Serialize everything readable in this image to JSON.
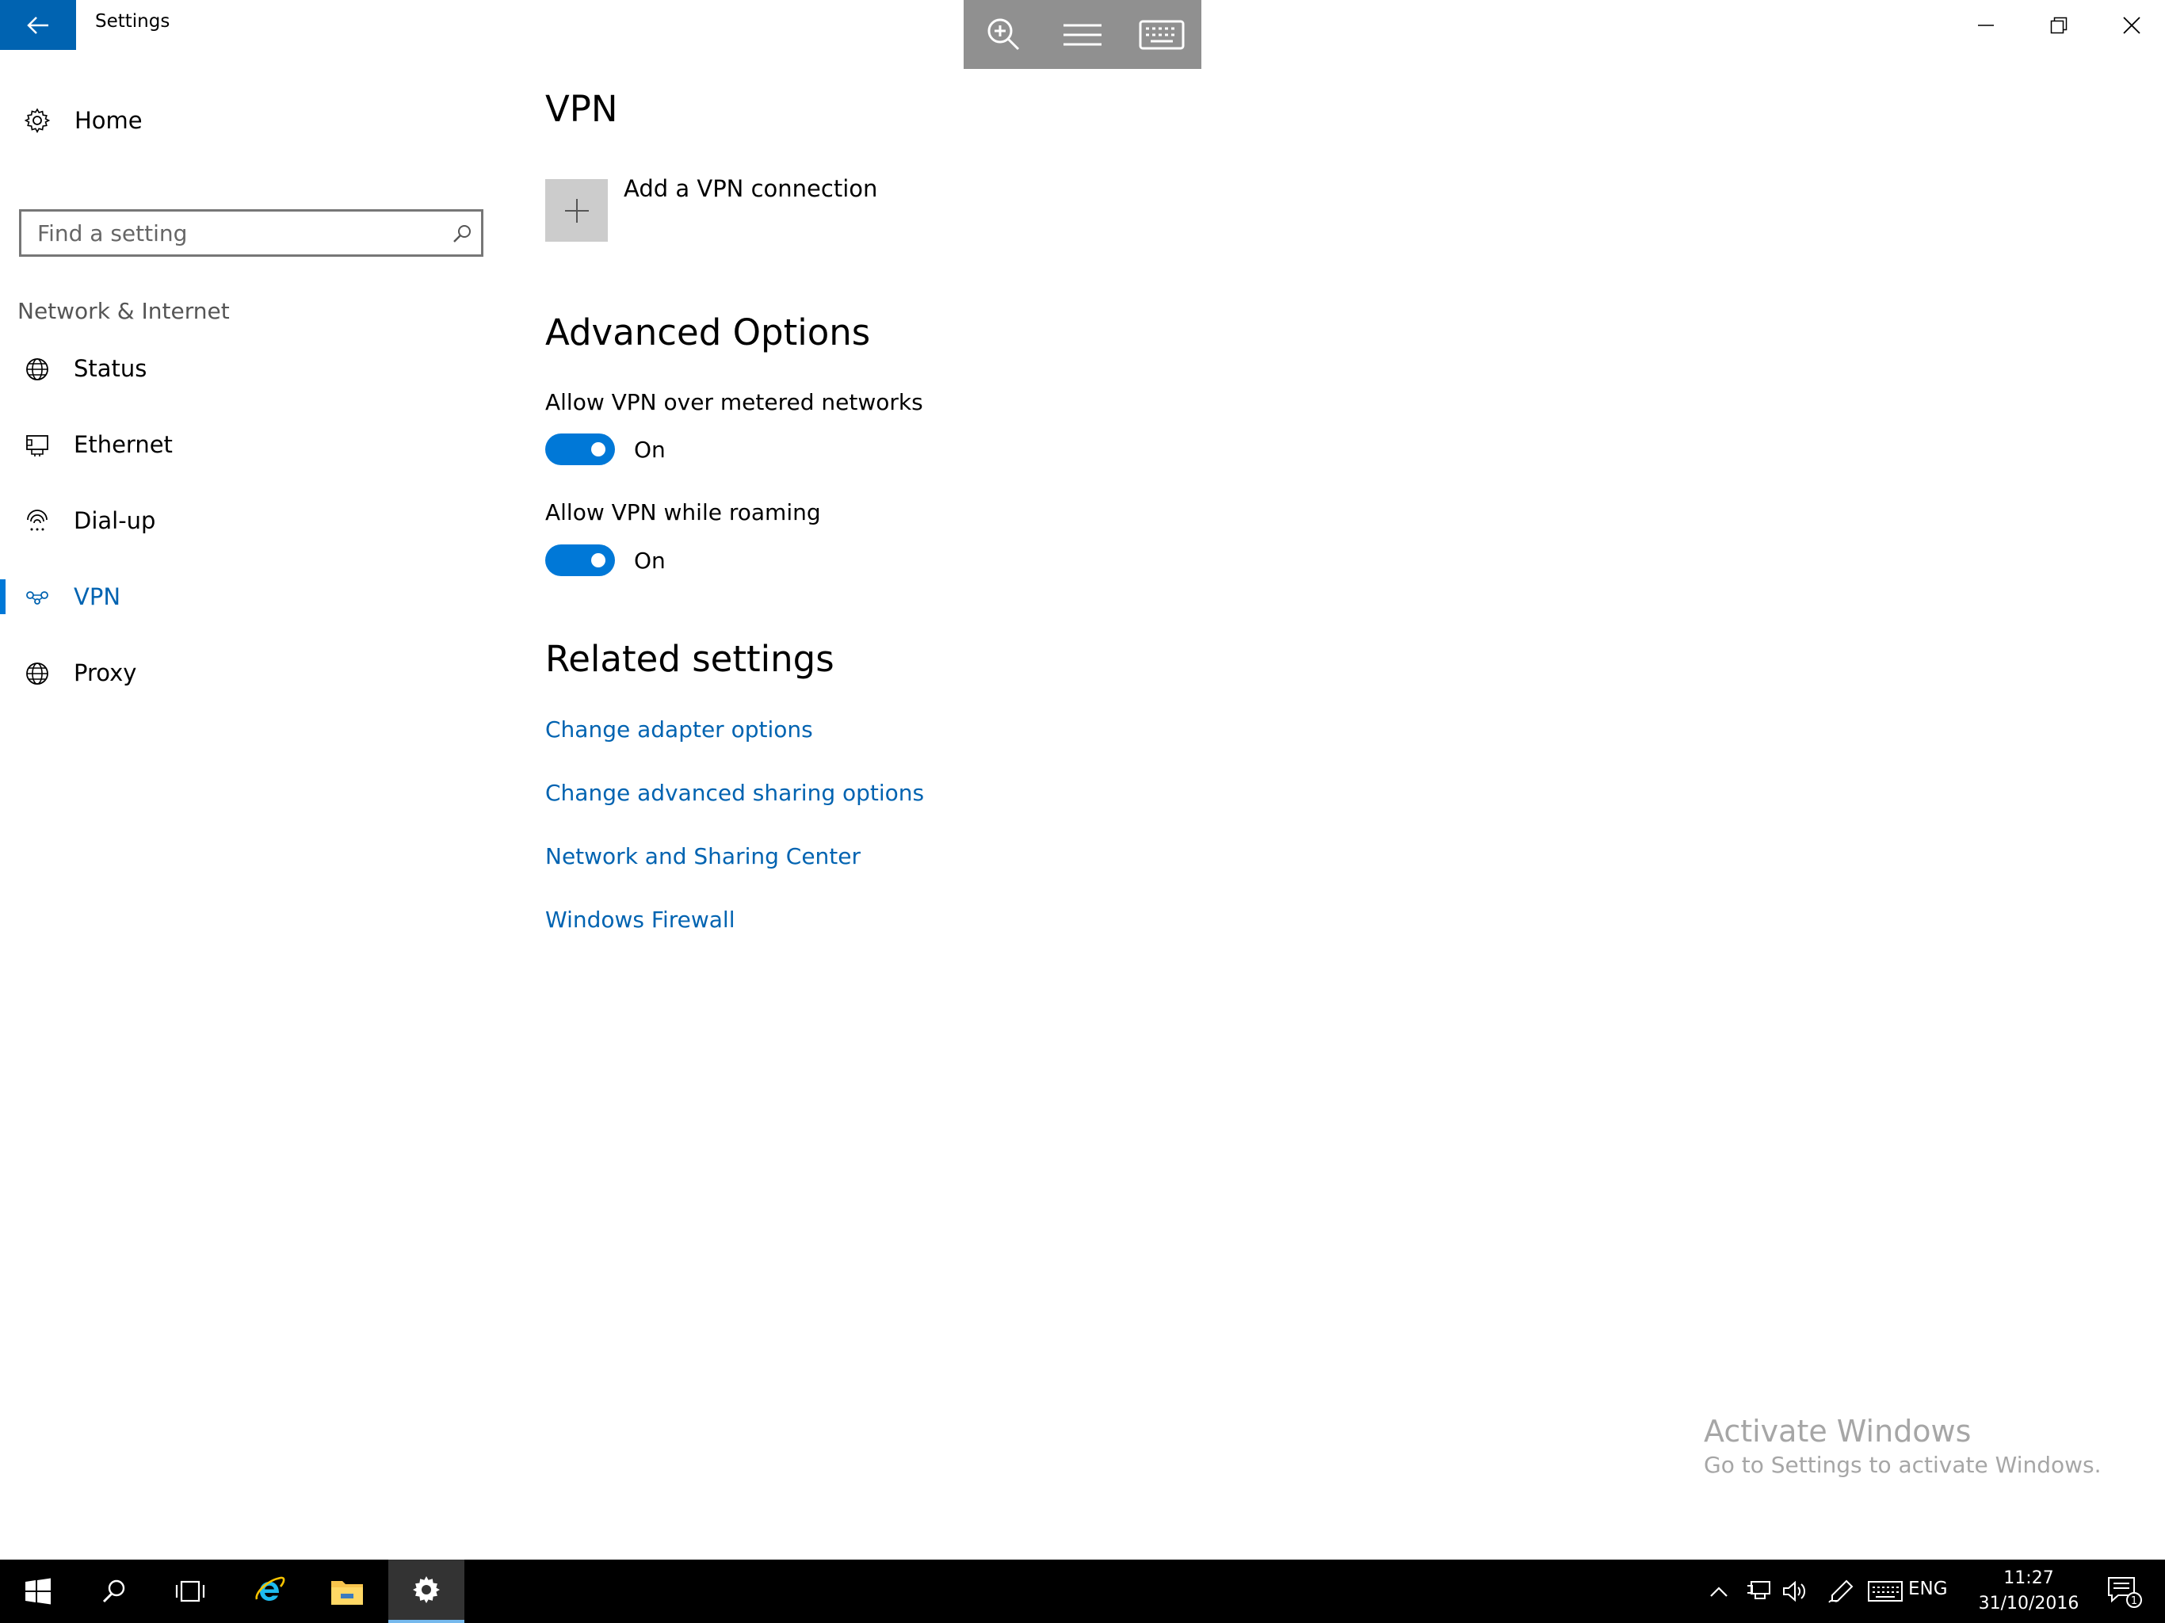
{
  "window": {
    "title": "Settings"
  },
  "sidebar": {
    "home_label": "Home",
    "search_placeholder": "Find a setting",
    "section_label": "Network & Internet",
    "items": [
      {
        "label": "Status",
        "icon": "globe-status-icon"
      },
      {
        "label": "Ethernet",
        "icon": "ethernet-icon"
      },
      {
        "label": "Dial-up",
        "icon": "dialup-icon"
      },
      {
        "label": "VPN",
        "icon": "vpn-icon",
        "active": true
      },
      {
        "label": "Proxy",
        "icon": "globe-icon"
      }
    ]
  },
  "main": {
    "title": "VPN",
    "add_vpn_label": "Add a VPN connection",
    "advanced_title": "Advanced Options",
    "options": [
      {
        "label": "Allow VPN over metered networks",
        "state": "On"
      },
      {
        "label": "Allow VPN while roaming",
        "state": "On"
      }
    ],
    "related_title": "Related settings",
    "related_links": [
      "Change adapter options",
      "Change advanced sharing options",
      "Network and Sharing Center",
      "Windows Firewall"
    ]
  },
  "watermark": {
    "title": "Activate Windows",
    "subtitle": "Go to Settings to activate Windows."
  },
  "taskbar": {
    "language": "ENG",
    "time": "11:27",
    "date": "31/10/2016",
    "notification_count": "1"
  },
  "colors": {
    "accent": "#0078d7",
    "link": "#0063b1",
    "taskbar": "#000000"
  }
}
